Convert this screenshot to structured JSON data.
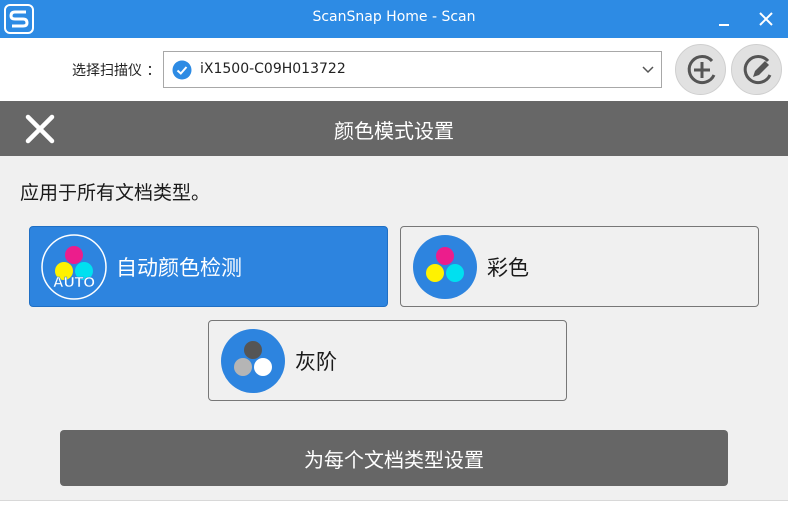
{
  "window": {
    "title": "ScanSnap Home - Scan",
    "minimize_icon": "minimize-icon",
    "close_icon": "close-icon"
  },
  "toolbar": {
    "scanner_label": "选择扫描仪 ：",
    "scanner_value": "iX1500-C09H013722",
    "scanner_status_icon": "check-circle-icon",
    "add_button_icon": "add-icon",
    "edit_button_icon": "edit-icon"
  },
  "header": {
    "title": "颜色模式设置",
    "close_icon": "close-x-icon"
  },
  "content": {
    "instruction": "应用于所有文档类型。",
    "modes": [
      {
        "label": "自动颜色检测",
        "icon": "auto-color-icon",
        "icon_text": "AUTO",
        "selected": true
      },
      {
        "label": "彩色",
        "icon": "color-icon",
        "selected": false
      },
      {
        "label": "灰阶",
        "icon": "grayscale-icon",
        "selected": false
      }
    ],
    "per_doc_button": "为每个文档类型设置"
  },
  "colors": {
    "accent": "#2d8be4",
    "selected": "#2d84df",
    "header": "#676767",
    "magenta": "#ec1d8c",
    "yellow": "#fff200",
    "cyan": "#00e0f0"
  }
}
